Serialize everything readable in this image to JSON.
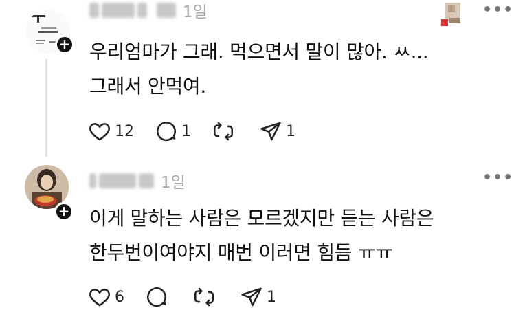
{
  "posts": [
    {
      "username": "",
      "time": "1일",
      "text": "우리엄마가 그래. 먹으면서 말이 많아. ㅆ...\n그래서 안먹여.",
      "likes": "12",
      "replies": "1",
      "reposts": "",
      "shares": "1",
      "more_label": "•••",
      "icons": [
        "heart-icon",
        "comment-icon",
        "repost-icon",
        "send-icon",
        "plus-icon",
        "more-icon"
      ]
    },
    {
      "username": "",
      "time": "1일",
      "text": "이게 말하는 사람은 모르겠지만 듣는 사람은\n한두번이여야지 매번 이러면 힘듬 ㅠㅠ",
      "likes": "6",
      "replies": "",
      "reposts": "",
      "shares": "1",
      "more_label": "•••",
      "icons": [
        "heart-icon",
        "comment-icon",
        "repost-icon",
        "send-icon",
        "plus-icon",
        "more-icon"
      ]
    }
  ],
  "colors": {
    "text": "#111111",
    "muted": "#a8a8a8",
    "icon": "#222222",
    "thread_line": "#e2e2e2"
  }
}
